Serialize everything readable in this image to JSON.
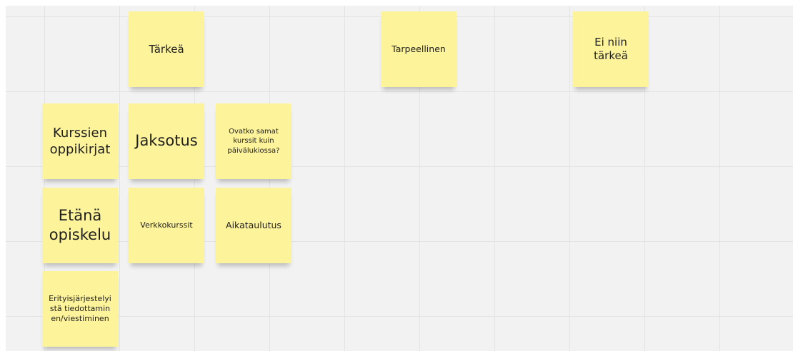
{
  "board": {
    "notes": [
      {
        "id": "tarkea",
        "text": "Tärkeä"
      },
      {
        "id": "tarpeellinen",
        "text": "Tarpeellinen"
      },
      {
        "id": "ei-niin-tarkea",
        "text": "Ei niin tärkeä"
      },
      {
        "id": "kurssien-oppikirjat",
        "text": "Kurssien oppikirjat"
      },
      {
        "id": "jaksotus",
        "text": "Jaksotus"
      },
      {
        "id": "ovatko-samat",
        "text": "Ovatko samat kurssit kuin päivälukiossa?"
      },
      {
        "id": "etana-opiskelu",
        "text": "Etänä opiskelu"
      },
      {
        "id": "verkkokurssit",
        "text": "Verkkokurssit"
      },
      {
        "id": "aikataulutus",
        "text": "Aikataulutus"
      },
      {
        "id": "erityisjarjestelyista",
        "text": "Erityisjärjestelyistä tiedottaminen/viestiminen"
      }
    ],
    "colors": {
      "note": "#fdf39b",
      "background": "#f2f2f2",
      "grid": "#e3e3e3"
    }
  }
}
